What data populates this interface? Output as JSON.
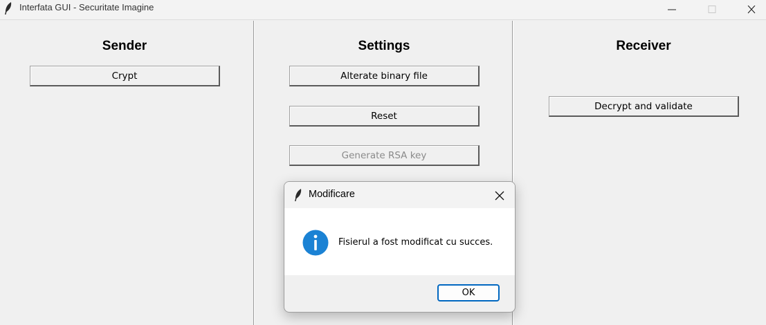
{
  "window": {
    "title": "Interfata GUI - Securitate Imagine"
  },
  "sender": {
    "heading": "Sender",
    "crypt_label": "Crypt"
  },
  "settings": {
    "heading": "Settings",
    "alterate_label": "Alterate binary file",
    "reset_label": "Reset",
    "generate_rsa_label": "Generate RSA key",
    "generate_rsa_disabled": true
  },
  "receiver": {
    "heading": "Receiver",
    "decrypt_label": "Decrypt and validate"
  },
  "dialog": {
    "title": "Modificare",
    "message": "Fisierul a fost modificat cu succes.",
    "ok_label": "OK",
    "icon": "info-icon"
  },
  "colors": {
    "background": "#f0f0f0",
    "accent": "#0067c0",
    "info_icon": "#1b82d4"
  }
}
